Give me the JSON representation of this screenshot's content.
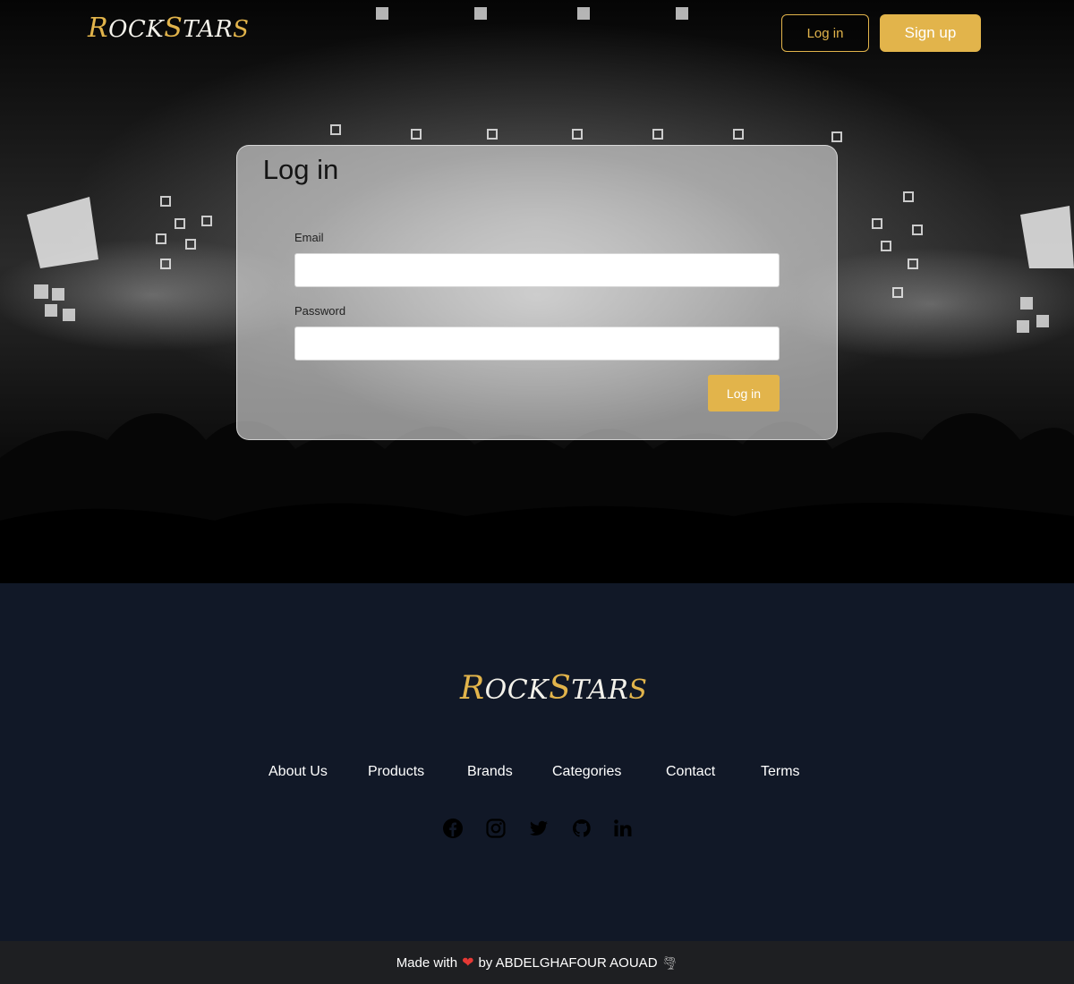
{
  "brand": {
    "logo_parts": [
      "R",
      "OCK",
      "S",
      "TAR",
      "S"
    ],
    "accent_color": "#e2b44b"
  },
  "nav": {
    "login_label": "Log in",
    "signup_label": "Sign up"
  },
  "login_form": {
    "title": "Log in",
    "email_label": "Email",
    "email_value": "",
    "password_label": "Password",
    "password_value": "",
    "submit_label": "Log in"
  },
  "footer": {
    "links": [
      "About Us",
      "Products",
      "Brands",
      "Categories",
      "Contact",
      "Terms"
    ],
    "socials": [
      "facebook-icon",
      "instagram-icon",
      "twitter-icon",
      "github-icon",
      "linkedin-icon"
    ],
    "made_with_prefix": "Made with",
    "made_with_suffix": "by ABDELGHAFOUR AOUAD",
    "background_color": "#111827"
  }
}
